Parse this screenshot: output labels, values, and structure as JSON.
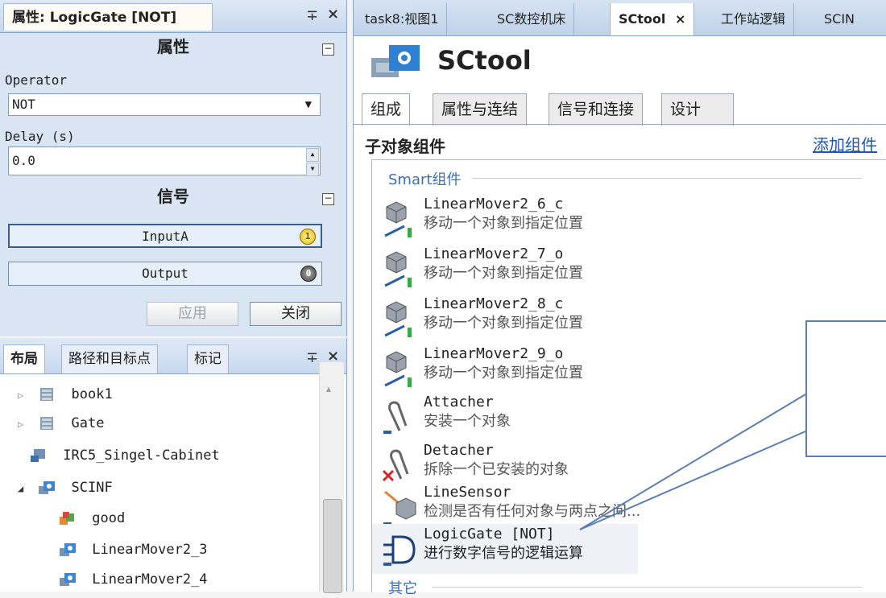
{
  "props": {
    "title": "属性: LogicGate [NOT]",
    "pin_glyph": "∓",
    "close_glyph": "×",
    "section_props": "属性",
    "operator_label": "Operator",
    "operator_value": "NOT",
    "delay_label": "Delay (s)",
    "delay_value": "0.0",
    "section_signals": "信号",
    "collapse_glyph": "−",
    "signals": [
      {
        "name": "InputA",
        "value": "1"
      },
      {
        "name": "Output",
        "value": "0"
      }
    ],
    "apply_label": "应用",
    "close_label": "关闭"
  },
  "layout": {
    "tabs": [
      "布局",
      "路径和目标点",
      "标记"
    ],
    "items": [
      {
        "label": "book1",
        "expander": "▷"
      },
      {
        "label": "Gate",
        "expander": "▷"
      },
      {
        "label": "IRC5_Singel-Cabinet",
        "expander": ""
      },
      {
        "label": "SCINF",
        "expander": "◢"
      },
      {
        "label": "good",
        "expander": ""
      },
      {
        "label": "LinearMover2_3",
        "expander": ""
      },
      {
        "label": "LinearMover2_4",
        "expander": ""
      }
    ],
    "scroll_up_glyph": "▴"
  },
  "doc": {
    "tabs": [
      "task8:视图1",
      "SC数控机床",
      "SCtool",
      "工作站逻辑",
      "SCIN"
    ],
    "tab_close_glyph": "×",
    "title": "SCtool",
    "subtabs": [
      "组成",
      "属性与连结",
      "信号和连接",
      "设计"
    ],
    "pane_heading": "子对象组件",
    "add_link": "添加组件",
    "group_smart": "Smart组件",
    "group_other": "其它",
    "components": [
      {
        "name": "LinearMover2_6_c",
        "desc": "移动一个对象到指定位置",
        "icon": "linear-mover-icon"
      },
      {
        "name": "LinearMover2_7_o",
        "desc": "移动一个对象到指定位置",
        "icon": "linear-mover-icon"
      },
      {
        "name": "LinearMover2_8_c",
        "desc": "移动一个对象到指定位置",
        "icon": "linear-mover-icon"
      },
      {
        "name": "LinearMover2_9_o",
        "desc": "移动一个对象到指定位置",
        "icon": "linear-mover-icon"
      },
      {
        "name": "Attacher",
        "desc": "安装一个对象",
        "icon": "attacher-icon"
      },
      {
        "name": "Detacher",
        "desc": "拆除一个已安装的对象",
        "icon": "detacher-icon"
      },
      {
        "name": "LineSensor",
        "desc": "检测是否有任何对象与两点之间...",
        "icon": "line-sensor-icon"
      },
      {
        "name": "LogicGate [NOT]",
        "desc": "进行数字信号的逻辑运算",
        "icon": "logic-gate-icon"
      }
    ]
  }
}
